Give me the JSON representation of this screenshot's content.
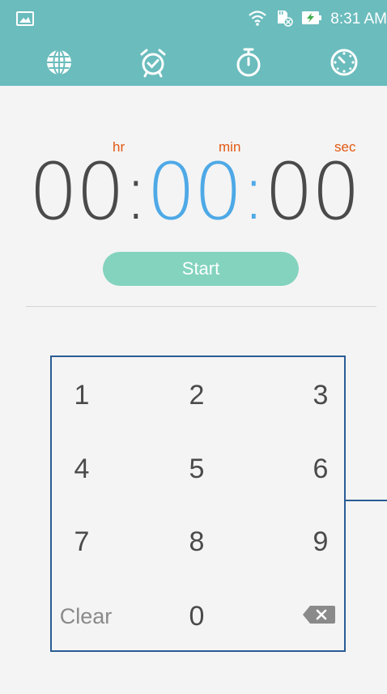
{
  "status_bar": {
    "time": "8:31 AM",
    "icons": [
      "image-icon",
      "wifi-icon",
      "sd-card-icon",
      "battery-charging-icon"
    ]
  },
  "tabs": [
    {
      "name": "world-clock",
      "icon": "globe-icon"
    },
    {
      "name": "alarm",
      "icon": "alarm-clock-icon"
    },
    {
      "name": "stopwatch",
      "icon": "stopwatch-icon"
    },
    {
      "name": "timer",
      "icon": "timer-icon",
      "selected": true
    }
  ],
  "timer": {
    "labels": {
      "hr": "hr",
      "min": "min",
      "sec": "sec"
    },
    "hours": "00",
    "minutes": "00",
    "seconds": "00",
    "separator": ":"
  },
  "start_label": "Start",
  "keypad": {
    "keys": [
      "1",
      "2",
      "3",
      "4",
      "5",
      "6",
      "7",
      "8",
      "9"
    ],
    "clear_label": "Clear",
    "zero": "0",
    "backspace_icon": "backspace-icon"
  },
  "colors": {
    "header_bg": "#6bbcbd",
    "label_orange": "#e25811",
    "digits_gray": "#4a4a4a",
    "digits_blue": "#4ea9e6",
    "start_button": "#83d3be",
    "keypad_border": "#2a5c94"
  }
}
